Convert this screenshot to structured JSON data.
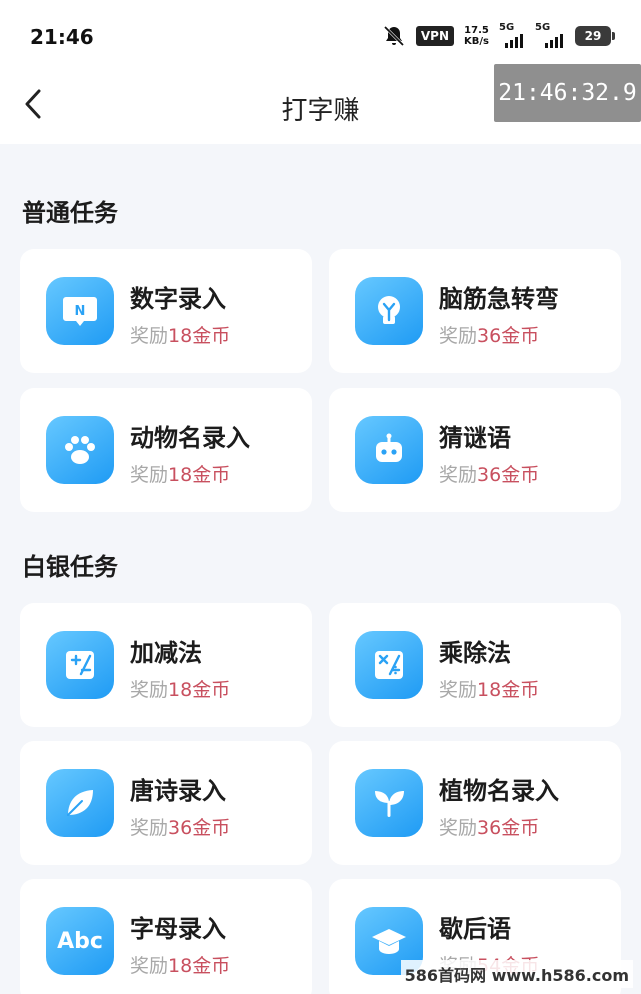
{
  "status_bar": {
    "time": "21:46",
    "vpn": "VPN",
    "speed_value": "17.5",
    "speed_unit": "KB/s",
    "network_1": "5G",
    "network_2": "5G",
    "battery": "29"
  },
  "nav": {
    "title": "打字赚",
    "back_icon": "chevron-left-icon"
  },
  "overlay_clock": "21:46:32.9",
  "sections": [
    {
      "title": "普通任务",
      "tasks": [
        {
          "name": "数字录入",
          "reward_prefix": "奖励",
          "reward_amount": "18金币",
          "icon": "chat-bubble-n-icon"
        },
        {
          "name": "脑筋急转弯",
          "reward_prefix": "奖励",
          "reward_amount": "36金币",
          "icon": "lightbulb-icon"
        },
        {
          "name": "动物名录入",
          "reward_prefix": "奖励",
          "reward_amount": "18金币",
          "icon": "paw-icon"
        },
        {
          "name": "猜谜语",
          "reward_prefix": "奖励",
          "reward_amount": "36金币",
          "icon": "robot-icon"
        }
      ]
    },
    {
      "title": "白银任务",
      "tasks": [
        {
          "name": "加减法",
          "reward_prefix": "奖励",
          "reward_amount": "18金币",
          "icon": "plus-minus-icon"
        },
        {
          "name": "乘除法",
          "reward_prefix": "奖励",
          "reward_amount": "18金币",
          "icon": "multiply-divide-icon"
        },
        {
          "name": "唐诗录入",
          "reward_prefix": "奖励",
          "reward_amount": "36金币",
          "icon": "leaf-icon"
        },
        {
          "name": "植物名录入",
          "reward_prefix": "奖励",
          "reward_amount": "36金币",
          "icon": "sprout-icon"
        },
        {
          "name": "字母录入",
          "reward_prefix": "奖励",
          "reward_amount": "18金币",
          "icon": "abc-icon",
          "icon_text": "Abc"
        },
        {
          "name": "歇后语",
          "reward_prefix": "奖励",
          "reward_amount": "54金币",
          "icon": "graduation-cap-icon"
        }
      ]
    }
  ],
  "watermark": "586首码网 www.h586.com",
  "colors": {
    "accent_reward": "#c8505f",
    "icon_gradient_start": "#66c8ff",
    "icon_gradient_end": "#1f9bf4",
    "background": "#f4f6fa"
  }
}
